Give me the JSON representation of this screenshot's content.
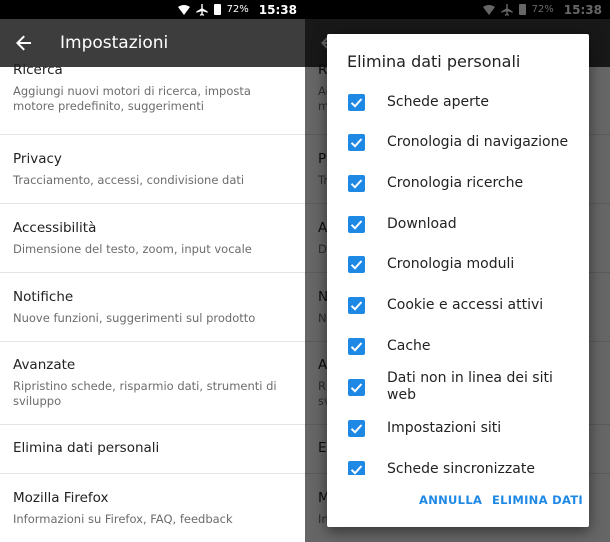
{
  "status": {
    "battery": "72%",
    "time": "15:38"
  },
  "appbar": {
    "title": "Impostazioni"
  },
  "settings": [
    {
      "title": "Ricerca",
      "subtitle": "Aggiungi nuovi motori di ricerca, imposta motore predefinito, suggerimenti"
    },
    {
      "title": "Privacy",
      "subtitle": "Tracciamento, accessi, condivisione dati"
    },
    {
      "title": "Accessibilità",
      "subtitle": "Dimensione del testo, zoom, input vocale"
    },
    {
      "title": "Notifiche",
      "subtitle": "Nuove funzioni, suggerimenti sul prodotto"
    },
    {
      "title": "Avanzate",
      "subtitle": "Ripristino schede, risparmio dati, strumenti di sviluppo"
    },
    {
      "title": "Elimina dati personali",
      "subtitle": ""
    },
    {
      "title": "Mozilla Firefox",
      "subtitle": "Informazioni su Firefox, FAQ, feedback"
    }
  ],
  "dialog": {
    "title": "Elimina dati personali",
    "options": [
      {
        "label": "Schede aperte",
        "checked": true
      },
      {
        "label": "Cronologia di navigazione",
        "checked": true
      },
      {
        "label": "Cronologia ricerche",
        "checked": true
      },
      {
        "label": "Download",
        "checked": true
      },
      {
        "label": "Cronologia moduli",
        "checked": true
      },
      {
        "label": "Cookie e accessi attivi",
        "checked": true
      },
      {
        "label": "Cache",
        "checked": true
      },
      {
        "label": "Dati non in linea dei siti web",
        "checked": true
      },
      {
        "label": "Impostazioni siti",
        "checked": true
      },
      {
        "label": "Schede sincronizzate",
        "checked": true
      }
    ],
    "cancel_label": "ANNULLA",
    "confirm_label": "ELIMINA DATI"
  },
  "colors": {
    "appbar": "#3d3d3d",
    "accent": "#1e88e5",
    "statusbar": "#000000"
  },
  "icons": [
    "wifi-icon",
    "airplane-icon",
    "battery-icon",
    "back-arrow-icon",
    "checkbox-checked-icon"
  ]
}
